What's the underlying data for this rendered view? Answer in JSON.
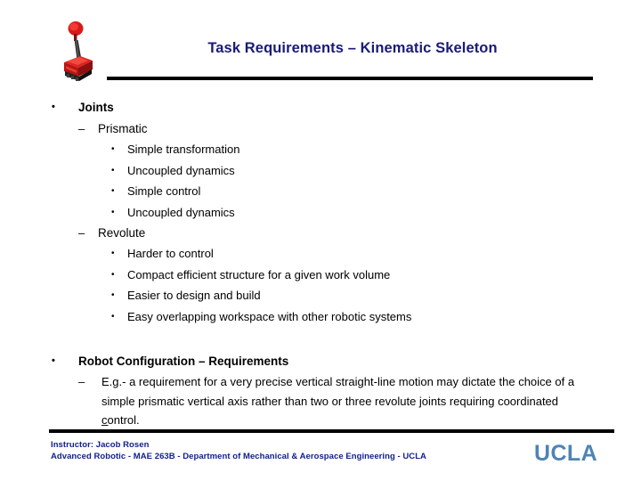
{
  "slide": {
    "title": "Task Requirements – Kinematic Skeleton",
    "title_color": "#1a1a78",
    "background": "#ffffff",
    "logo_icon": "robot-icon"
  },
  "outline": [
    {
      "level": 1,
      "bullet": "•",
      "text": "Joints",
      "bold": true
    },
    {
      "level": 2,
      "bullet": "–",
      "text": "Prismatic",
      "bold": false
    },
    {
      "level": 3,
      "bullet": "•",
      "text": "Simple transformation",
      "bold": false
    },
    {
      "level": 3,
      "bullet": "•",
      "text": "Uncoupled dynamics",
      "bold": false
    },
    {
      "level": 3,
      "bullet": "•",
      "text": "Simple control",
      "bold": false
    },
    {
      "level": 3,
      "bullet": "•",
      "text": "Uncoupled dynamics",
      "bold": false
    },
    {
      "level": 2,
      "bullet": "–",
      "text": "Revolute",
      "bold": false
    },
    {
      "level": 3,
      "bullet": "•",
      "text": "Harder to control",
      "bold": false
    },
    {
      "level": 3,
      "bullet": "•",
      "text": "Compact efficient structure for a given work volume",
      "bold": false
    },
    {
      "level": 3,
      "bullet": "•",
      "text": "Easier to design and build",
      "bold": false
    },
    {
      "level": 3,
      "bullet": "•",
      "text": "Easy overlapping workspace with other robotic systems",
      "bold": false
    },
    {
      "level": 1,
      "bullet": "•",
      "text": "Robot Configuration – Requirements",
      "bold": true
    },
    {
      "level": 2,
      "bullet": "–",
      "text": "E.g.- a requirement for a very precise vertical straight-line motion may dictate the choice of a simple prismatic vertical axis rather than two or three revolute joints requiring coordinated control.",
      "bold": false
    },
    {
      "level": 2,
      "bullet": "–",
      "text": "",
      "bold": false
    }
  ],
  "footer": {
    "line1": "Instructor: Jacob Rosen",
    "line2": "Advanced Robotic - MAE 263B - Department of Mechanical & Aerospace Engineering - UCLA",
    "text_color": "#11218c",
    "logo": "UCLA",
    "logo_color": "#4e84b4"
  }
}
